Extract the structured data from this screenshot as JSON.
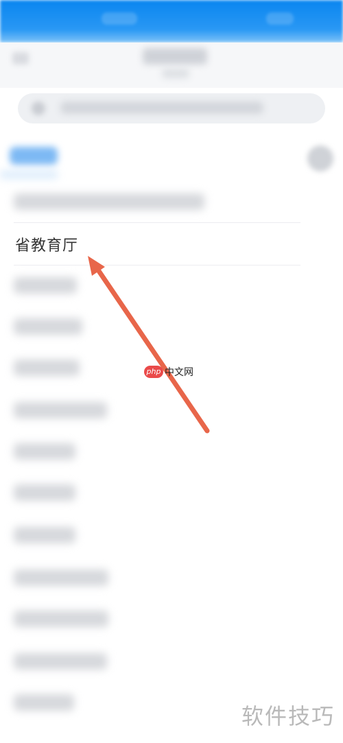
{
  "list": {
    "highlighted_item": "省教育厅"
  },
  "overlay": {
    "logo_badge": "php",
    "logo_site": "中文网",
    "watermark": "软件技巧",
    "arrow_color": "#e8664a"
  },
  "colors": {
    "status_bar": "#0a86f0",
    "tab_accent": "#7db9f4"
  }
}
